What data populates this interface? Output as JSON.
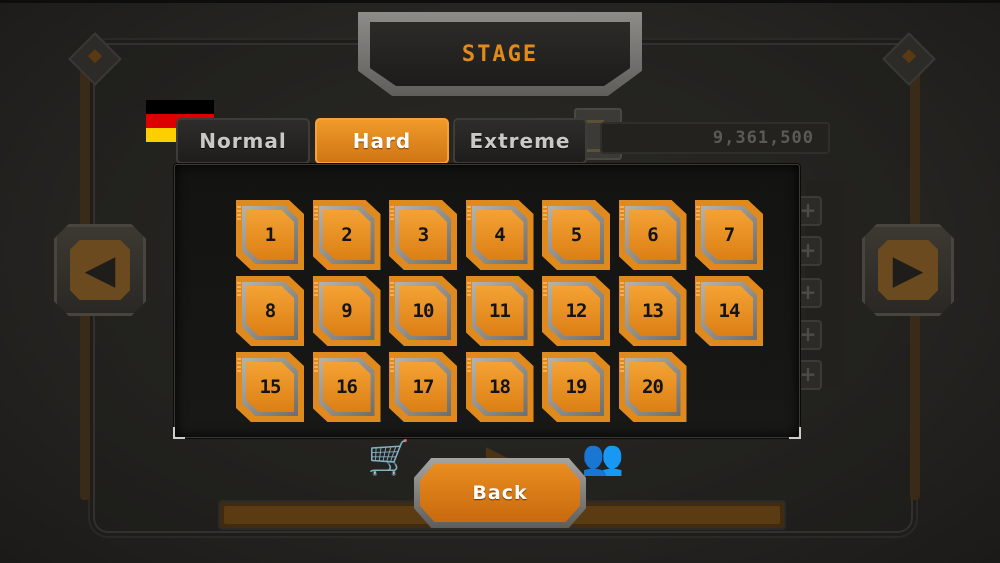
{
  "title": "STAGE",
  "tabs": [
    {
      "label": "Normal",
      "active": false
    },
    {
      "label": "Hard",
      "active": true
    },
    {
      "label": "Extreme",
      "active": false
    }
  ],
  "stages": [
    "1",
    "2",
    "3",
    "4",
    "5",
    "6",
    "7",
    "8",
    "9",
    "10",
    "11",
    "12",
    "13",
    "14",
    "15",
    "16",
    "17",
    "18",
    "19",
    "20"
  ],
  "back_label": "Back",
  "background": {
    "score": "9,361,500",
    "left_arrow_icon": "arrow-left-icon",
    "right_arrow_icon": "arrow-right-icon",
    "shop_icon": "cart-icon",
    "play_icon": "play-icon",
    "friends_icon": "people-icon"
  },
  "colors": {
    "accent": "#e28a1c",
    "tab_active": "#f09a2a",
    "panel": "#131312",
    "flag": [
      "#000000",
      "#dd0000",
      "#ffce00"
    ]
  }
}
